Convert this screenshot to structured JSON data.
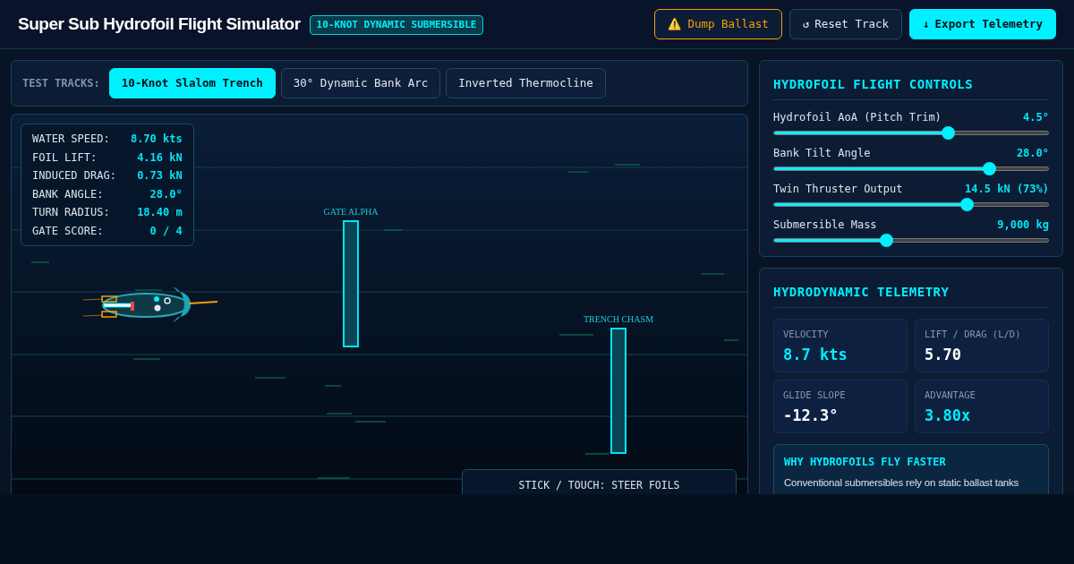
{
  "header": {
    "title": "Super Sub Hydrofoil Flight Simulator",
    "badge": "10-KNOT DYNAMIC SUBMERSIBLE",
    "buttons": [
      {
        "kind": "warning",
        "icon": "⚠️",
        "label": "Dump Ballast"
      },
      {
        "kind": "plain",
        "icon": "↺",
        "label": "Reset Track"
      },
      {
        "kind": "primary",
        "icon": "↓",
        "label": "Export Telemetry"
      }
    ]
  },
  "tracks": {
    "label": "TEST TRACKS:",
    "items": [
      {
        "label": "10-Knot Slalom Trench",
        "selected": true
      },
      {
        "label": "30° Dynamic Bank Arc",
        "selected": false
      },
      {
        "label": "Inverted Thermocline",
        "selected": false
      }
    ]
  },
  "hud": [
    {
      "label": "WATER SPEED:",
      "value": "8.70 kts"
    },
    {
      "label": "FOIL LIFT:",
      "value": "4.16 kN"
    },
    {
      "label": "INDUCED DRAG:",
      "value": "0.73 kN"
    },
    {
      "label": "BANK ANGLE:",
      "value": "28.0°"
    },
    {
      "label": "TURN RADIUS:",
      "value": "18.40 m"
    },
    {
      "label": "GATE SCORE:",
      "value": "0 / 4"
    }
  ],
  "gates": [
    {
      "label": "GATE ALPHA"
    },
    {
      "label": "TRENCH CHASM"
    }
  ],
  "hint": "STICK / TOUCH: STEER FOILS",
  "controls": {
    "title": "HYDROFOIL FLIGHT CONTROLS",
    "sliders": [
      {
        "label": "Hydrofoil AoA (Pitch Trim)",
        "reading": "4.5°",
        "level": 0.64
      },
      {
        "label": "Bank Tilt Angle",
        "reading": "28.0°",
        "level": 0.8
      },
      {
        "label": "Twin Thruster Output",
        "reading": "14.5 kN (73%)",
        "level": 0.715
      },
      {
        "label": "Submersible Mass",
        "reading": "9,000 kg",
        "level": 0.405
      }
    ]
  },
  "telemetry": {
    "title": "HYDRODYNAMIC TELEMETRY",
    "stats": [
      {
        "label": "VELOCITY",
        "value": "8.7 kts",
        "highlight": true
      },
      {
        "label": "LIFT / DRAG (L/D)",
        "value": "5.70",
        "highlight": false
      },
      {
        "label": "GLIDE SLOPE",
        "value": "-12.3°",
        "highlight": false
      },
      {
        "label": "ADVANTAGE",
        "value": "3.80x",
        "highlight": true
      }
    ],
    "note": {
      "title": "WHY HYDROFOILS FLY FASTER",
      "text": "Conventional submersibles rely on static ballast tanks"
    }
  }
}
